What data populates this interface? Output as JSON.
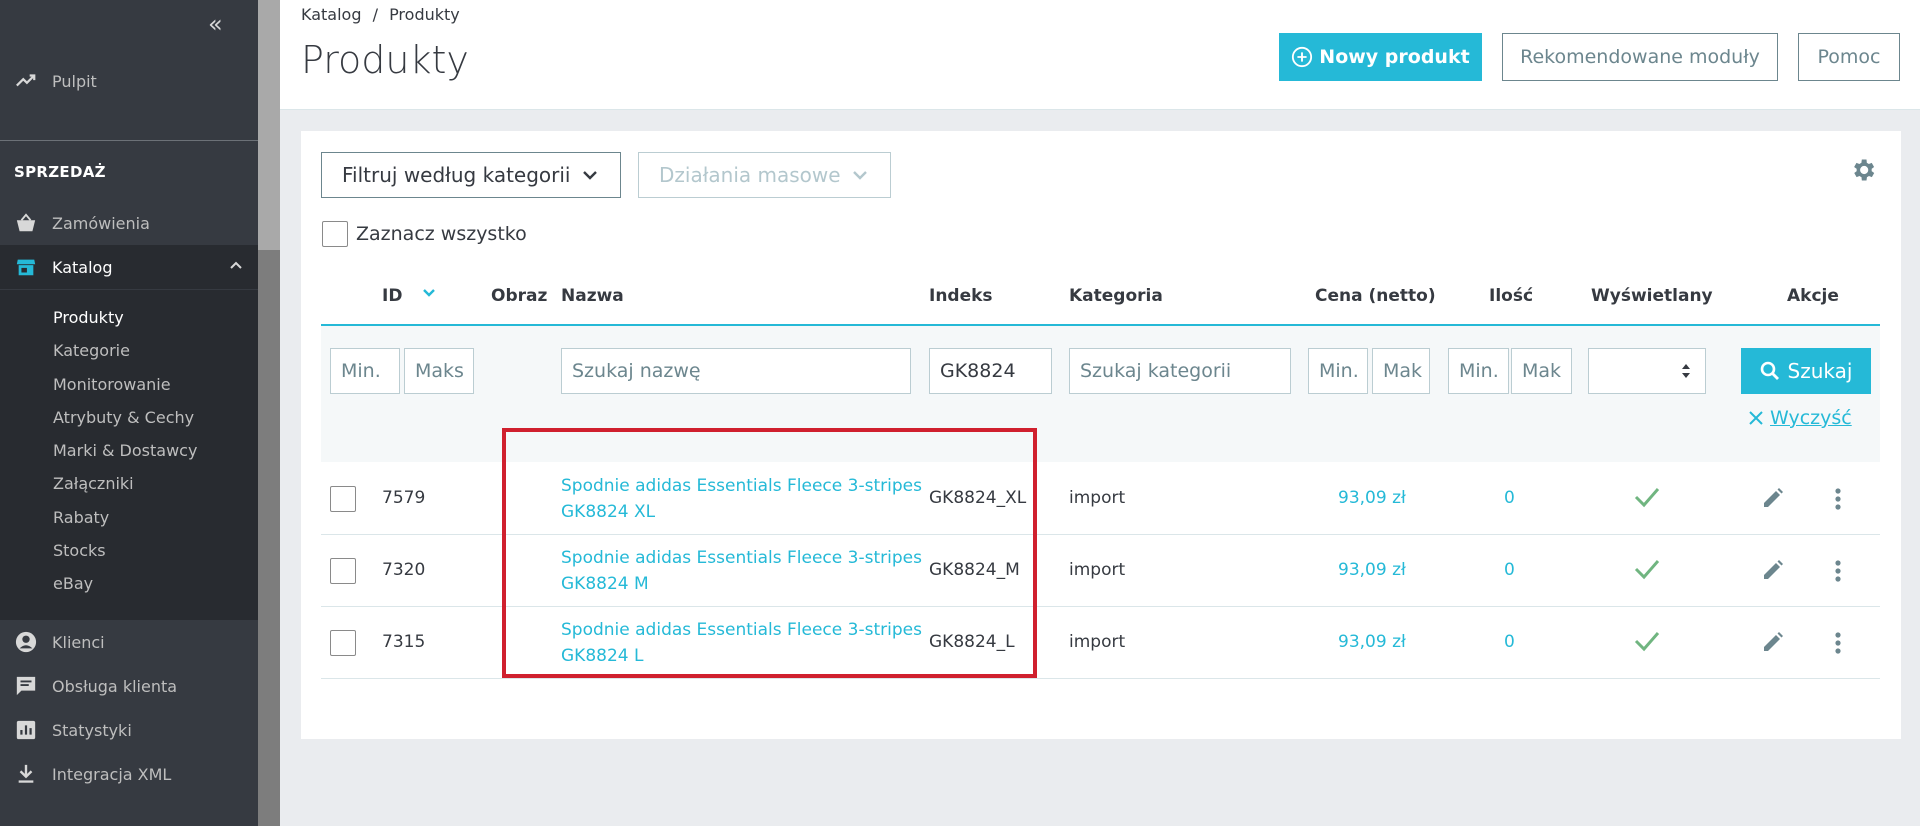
{
  "sidebar": {
    "dashboard": "Pulpit",
    "section": "SPRZEDAŻ",
    "orders": "Zamówienia",
    "catalog": "Katalog",
    "catalog_items": [
      "Produkty",
      "Kategorie",
      "Monitorowanie",
      "Atrybuty & Cechy",
      "Marki & Dostawcy",
      "Załączniki",
      "Rabaty",
      "Stocks",
      "eBay"
    ],
    "customers": "Klienci",
    "support": "Obsługa klienta",
    "stats": "Statystyki",
    "xml": "Integracja XML",
    "collapse_glyph": "«"
  },
  "header": {
    "breadcrumb_1": "Katalog",
    "breadcrumb_sep": "/",
    "breadcrumb_2": "Produkty",
    "title": "Produkty",
    "new_product": "Nowy produkt",
    "recommended": "Rekomendowane moduły",
    "help": "Pomoc"
  },
  "toolbar": {
    "filter_category": "Filtruj według kategorii",
    "bulk_actions": "Działania masowe",
    "select_all": "Zaznacz wszystko"
  },
  "columns": {
    "id": "ID",
    "image": "Obraz",
    "name": "Nazwa",
    "index": "Indeks",
    "category": "Kategoria",
    "price": "Cena (netto)",
    "qty": "Ilość",
    "displayed": "Wyświetlany",
    "actions": "Akcje"
  },
  "filters": {
    "min": "Min.",
    "max": "Maks",
    "max_short": "Mak",
    "name_placeholder": "Szukaj nazwę",
    "index_value": "GK8824",
    "category_placeholder": "Szukaj kategorii",
    "search": "Szukaj",
    "clear": "Wyczyść"
  },
  "rows": [
    {
      "id": "7579",
      "name_1": "Spodnie adidas Essentials Fleece 3-stripes",
      "name_2": "GK8824 XL",
      "index": "GK8824_XL",
      "category": "import",
      "price": "93,09 zł",
      "qty": "0"
    },
    {
      "id": "7320",
      "name_1": "Spodnie adidas Essentials Fleece 3-stripes",
      "name_2": "GK8824 M",
      "index": "GK8824_M",
      "category": "import",
      "price": "93,09 zł",
      "qty": "0"
    },
    {
      "id": "7315",
      "name_1": "Spodnie adidas Essentials Fleece 3-stripes",
      "name_2": "GK8824 L",
      "index": "GK8824_L",
      "category": "import",
      "price": "93,09 zł",
      "qty": "0"
    }
  ],
  "colors": {
    "accent": "#25b9d7",
    "success": "#70b580",
    "highlight": "#d0202e"
  }
}
